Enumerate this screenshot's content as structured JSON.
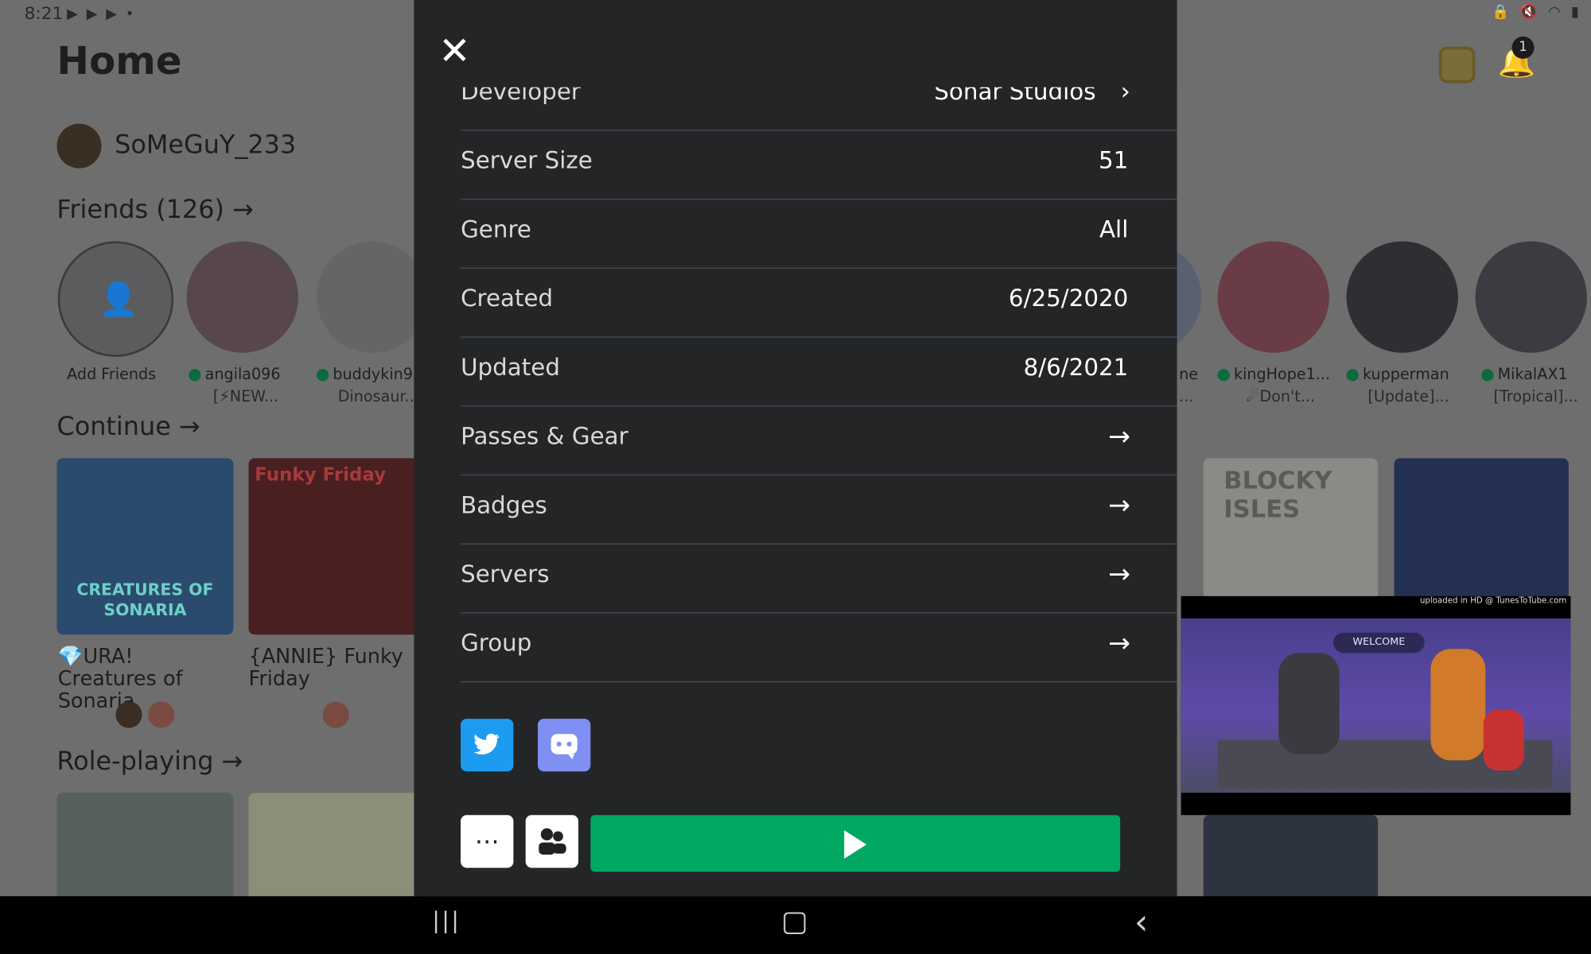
{
  "status_bar": {
    "time": "8:21",
    "left_icons": "▶ ▶ ▶ •",
    "right_icons": "🔒 🔇 ◠ ▮"
  },
  "home": {
    "title": "Home",
    "username": "SoMeGuY_233",
    "friends_title": "Friends (126)",
    "arrow": "→",
    "notifications_count": "1",
    "friends": [
      {
        "name": "Add Friends",
        "sub": ""
      },
      {
        "name": "angila096",
        "sub": "[⚡NEW..."
      },
      {
        "name": "buddykin9",
        "sub": "Dinosaur..."
      },
      {
        "name": "ne",
        "sub": "..."
      },
      {
        "name": "kingHope1...",
        "sub": "☄Don't..."
      },
      {
        "name": "kupperman",
        "sub": "[Update]..."
      },
      {
        "name": "MikalAX1",
        "sub": "[Tropical]..."
      }
    ],
    "continue_title": "Continue",
    "games": [
      {
        "title": "💎URA! Creatures of Sonaria",
        "art_text": "CREATURES OF SONARIA"
      },
      {
        "title": "{ANNIE} Funky Friday",
        "art_text": "Funky Friday"
      },
      {
        "title": "",
        "art_text": "BLOCKY ISLES"
      }
    ],
    "roleplaying_title": "Role-playing"
  },
  "modal": {
    "close_icon": "✕",
    "developer_label": "Developer",
    "developer_value": "Sonar Studios",
    "rows": [
      {
        "label": "Server Size",
        "value": "51"
      },
      {
        "label": "Genre",
        "value": "All"
      },
      {
        "label": "Created",
        "value": "6/25/2020"
      },
      {
        "label": "Updated",
        "value": "8/6/2021"
      }
    ],
    "links": [
      {
        "label": "Passes & Gear",
        "arrow": "→"
      },
      {
        "label": "Badges",
        "arrow": "→"
      },
      {
        "label": "Servers",
        "arrow": "→"
      },
      {
        "label": "Group",
        "arrow": "→"
      }
    ],
    "more_icon": "⋯"
  },
  "video": {
    "caption": "uploaded in HD @ TunesToTube.com",
    "welcome": "WELCOME"
  },
  "navbar": {
    "recents": "|||",
    "home": "▢",
    "back": "‹"
  },
  "colors": {
    "play": "#00a862",
    "modal_bg": "#232527",
    "twitter": "#1d9bf0",
    "discord": "#7f8ff4"
  }
}
